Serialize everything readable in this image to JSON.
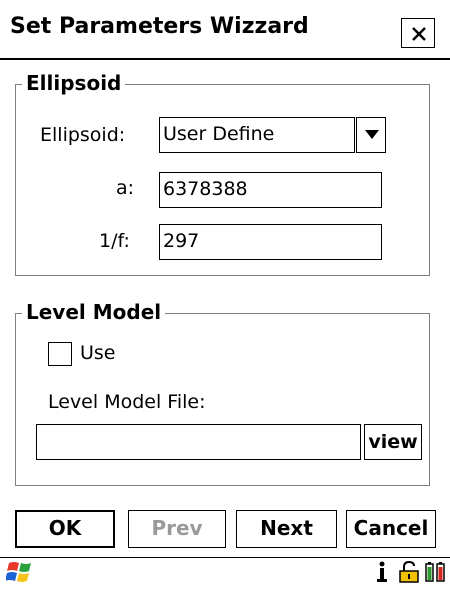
{
  "window": {
    "title": "Set Parameters Wizzard",
    "close_icon": "close-icon"
  },
  "ellipsoid_group": {
    "legend": "Ellipsoid",
    "ellipsoid_label": "Ellipsoid:",
    "ellipsoid_value": "User Define",
    "a_label": "a:",
    "a_value": "6378388",
    "f_label": "1/f:",
    "f_value": "297"
  },
  "level_model_group": {
    "legend": "Level Model",
    "use_label": "Use",
    "use_checked": false,
    "file_label": "Level Model File:",
    "file_value": "",
    "view_label": "view"
  },
  "buttons": {
    "ok": "OK",
    "prev": "Prev",
    "next": "Next",
    "cancel": "Cancel"
  },
  "taskbar": {
    "start_icon": "windows-start-icon",
    "tray_icons": [
      "info-icon",
      "lock-icon",
      "battery-icon"
    ]
  }
}
